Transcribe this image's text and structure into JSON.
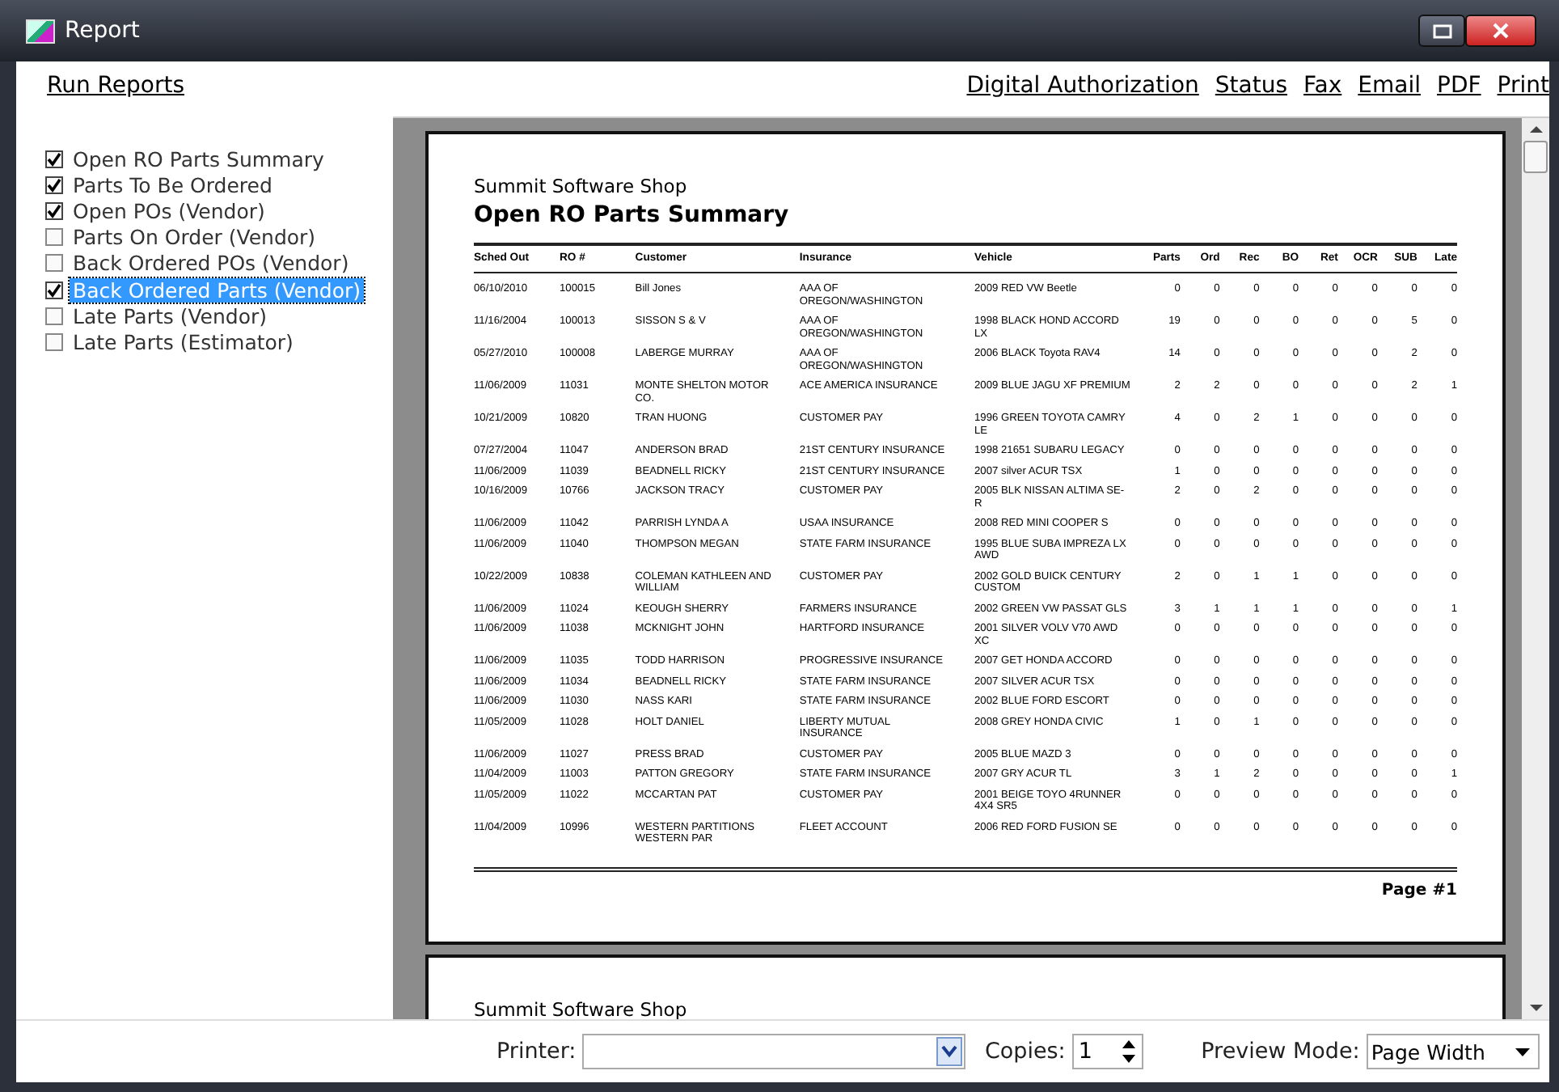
{
  "window": {
    "title": "Report"
  },
  "toolbar": {
    "left_link": "Run Reports",
    "right_links": [
      "Digital Authorization",
      "Status",
      "Fax",
      "Email",
      "PDF",
      "Print"
    ]
  },
  "reports": [
    {
      "label": "Open RO Parts Summary",
      "checked": true,
      "selected": false
    },
    {
      "label": "Parts To Be Ordered",
      "checked": true,
      "selected": false
    },
    {
      "label": "Open POs (Vendor)",
      "checked": true,
      "selected": false
    },
    {
      "label": "Parts On Order (Vendor)",
      "checked": false,
      "selected": false
    },
    {
      "label": "Back Ordered POs (Vendor)",
      "checked": false,
      "selected": false
    },
    {
      "label": "Back Ordered Parts (Vendor)",
      "checked": true,
      "selected": true
    },
    {
      "label": "Late Parts (Vendor)",
      "checked": false,
      "selected": false
    },
    {
      "label": "Late Parts (Estimator)",
      "checked": false,
      "selected": false
    }
  ],
  "preview": {
    "pages": [
      {
        "shop": "Summit Software Shop",
        "title": "Open RO Parts Summary",
        "page_number": "Page #1",
        "table": {
          "columns": [
            "Sched Out",
            "RO #",
            "Customer",
            "Insurance",
            "Vehicle",
            "Parts",
            "Ord",
            "Rec",
            "BO",
            "Ret",
            "OCR",
            "SUB",
            "Late"
          ],
          "rows": [
            [
              "06/10/2010",
              "100015",
              "Bill Jones",
              "AAA OF OREGON/WASHINGTON",
              "2009 RED VW Beetle",
              "0",
              "0",
              "0",
              "0",
              "0",
              "0",
              "0",
              "0"
            ],
            [
              "11/16/2004",
              "100013",
              "SISSON S & V",
              "AAA OF OREGON/WASHINGTON",
              "1998 BLACK HOND ACCORD LX",
              "19",
              "0",
              "0",
              "0",
              "0",
              "0",
              "5",
              "0"
            ],
            [
              "05/27/2010",
              "100008",
              "LABERGE MURRAY",
              "AAA OF OREGON/WASHINGTON",
              "2006 BLACK Toyota RAV4",
              "14",
              "0",
              "0",
              "0",
              "0",
              "0",
              "2",
              "0"
            ],
            [
              "11/06/2009",
              "11031",
              "MONTE SHELTON MOTOR CO.",
              "ACE AMERICA INSURANCE",
              "2009 BLUE JAGU XF PREMIUM",
              "2",
              "2",
              "0",
              "0",
              "0",
              "0",
              "2",
              "1"
            ],
            [
              "10/21/2009",
              "10820",
              "TRAN HUONG",
              "CUSTOMER PAY",
              "1996 GREEN TOYOTA CAMRY LE",
              "4",
              "0",
              "2",
              "1",
              "0",
              "0",
              "0",
              "0"
            ],
            [
              "07/27/2004",
              "11047",
              "ANDERSON BRAD",
              "21ST CENTURY INSURANCE",
              "1998 21651 SUBARU LEGACY",
              "0",
              "0",
              "0",
              "0",
              "0",
              "0",
              "0",
              "0"
            ],
            [
              "11/06/2009",
              "11039",
              "BEADNELL RICKY",
              "21ST CENTURY INSURANCE",
              "2007 silver ACUR TSX",
              "1",
              "0",
              "0",
              "0",
              "0",
              "0",
              "0",
              "0"
            ],
            [
              "10/16/2009",
              "10766",
              "JACKSON TRACY",
              "CUSTOMER PAY",
              "2005 BLK NISSAN ALTIMA SE-R",
              "2",
              "0",
              "2",
              "0",
              "0",
              "0",
              "0",
              "0"
            ],
            [
              "11/06/2009",
              "11042",
              "PARRISH LYNDA A",
              "USAA INSURANCE",
              "2008 RED MINI COOPER S",
              "0",
              "0",
              "0",
              "0",
              "0",
              "0",
              "0",
              "0"
            ],
            [
              "11/06/2009",
              "11040",
              "THOMPSON MEGAN",
              "STATE FARM INSURANCE",
              "1995 BLUE SUBA IMPREZA LX AWD",
              "0",
              "0",
              "0",
              "0",
              "0",
              "0",
              "0",
              "0"
            ],
            [
              "10/22/2009",
              "10838",
              "COLEMAN KATHLEEN AND WILLIAM",
              "CUSTOMER PAY",
              "2002 GOLD BUICK CENTURY CUSTOM",
              "2",
              "0",
              "1",
              "1",
              "0",
              "0",
              "0",
              "0"
            ],
            [
              "11/06/2009",
              "11024",
              "KEOUGH SHERRY",
              "FARMERS INSURANCE",
              "2002 GREEN VW PASSAT GLS",
              "3",
              "1",
              "1",
              "1",
              "0",
              "0",
              "0",
              "1"
            ],
            [
              "11/06/2009",
              "11038",
              "MCKNIGHT JOHN",
              "HARTFORD INSURANCE",
              "2001 SILVER VOLV V70 AWD XC",
              "0",
              "0",
              "0",
              "0",
              "0",
              "0",
              "0",
              "0"
            ],
            [
              "11/06/2009",
              "11035",
              "TODD HARRISON",
              "PROGRESSIVE INSURANCE",
              "2007 GET HONDA ACCORD",
              "0",
              "0",
              "0",
              "0",
              "0",
              "0",
              "0",
              "0"
            ],
            [
              "11/06/2009",
              "11034",
              "BEADNELL RICKY",
              "STATE FARM INSURANCE",
              "2007 SILVER ACUR TSX",
              "0",
              "0",
              "0",
              "0",
              "0",
              "0",
              "0",
              "0"
            ],
            [
              "11/06/2009",
              "11030",
              "NASS KARI",
              "STATE FARM INSURANCE",
              "2002 BLUE FORD ESCORT",
              "0",
              "0",
              "0",
              "0",
              "0",
              "0",
              "0",
              "0"
            ],
            [
              "11/05/2009",
              "11028",
              "HOLT DANIEL",
              "LIBERTY MUTUAL INSURANCE",
              "2008 GREY HONDA CIVIC",
              "1",
              "0",
              "1",
              "0",
              "0",
              "0",
              "0",
              "0"
            ],
            [
              "11/06/2009",
              "11027",
              "PRESS BRAD",
              "CUSTOMER PAY",
              "2005 BLUE MAZD 3",
              "0",
              "0",
              "0",
              "0",
              "0",
              "0",
              "0",
              "0"
            ],
            [
              "11/04/2009",
              "11003",
              "PATTON GREGORY",
              "STATE FARM INSURANCE",
              "2007 GRY ACUR TL",
              "3",
              "1",
              "2",
              "0",
              "0",
              "0",
              "0",
              "1"
            ],
            [
              "11/05/2009",
              "11022",
              "MCCARTAN PAT",
              "CUSTOMER PAY",
              "2001 BEIGE TOYO 4RUNNER 4X4 SR5",
              "0",
              "0",
              "0",
              "0",
              "0",
              "0",
              "0",
              "0"
            ],
            [
              "11/04/2009",
              "10996",
              "WESTERN PARTITIONS WESTERN PAR",
              "FLEET ACCOUNT",
              "2006 RED FORD FUSION SE",
              "0",
              "0",
              "0",
              "0",
              "0",
              "0",
              "0",
              "0"
            ]
          ]
        }
      },
      {
        "shop": "Summit Software Shop"
      }
    ]
  },
  "bottom_bar": {
    "printer_label": "Printer:",
    "copies_label": "Copies:",
    "copies": "1",
    "preview_mode_label": "Preview Mode:",
    "preview_mode": "Page Width"
  }
}
